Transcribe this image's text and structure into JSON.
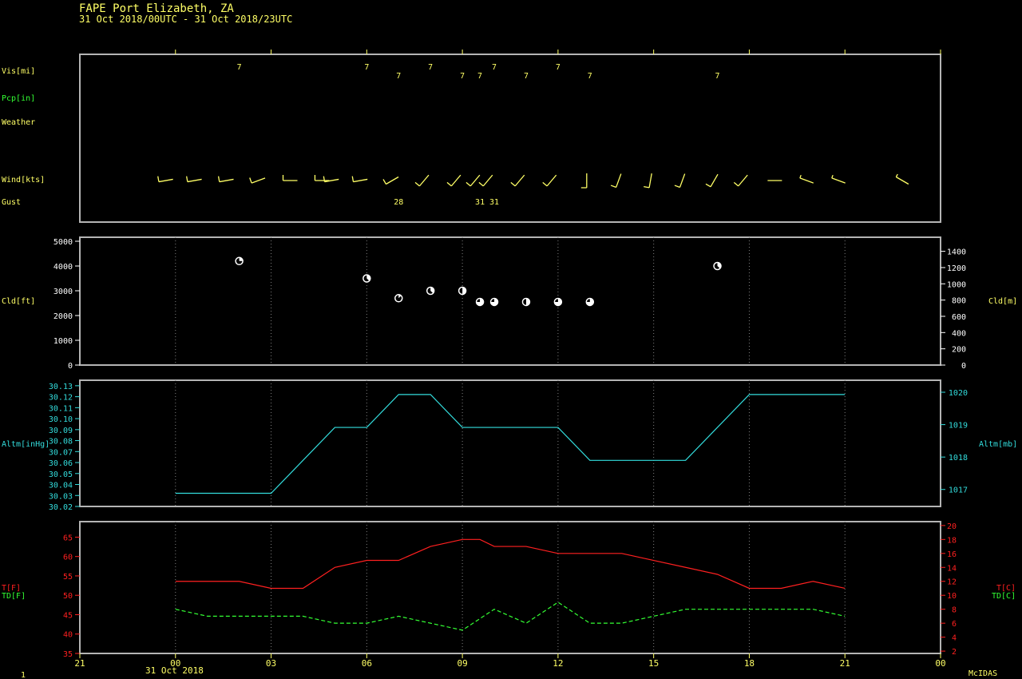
{
  "header": {
    "station": "FAPE  Port Elizabeth,  ZA",
    "period": "31 Oct 2018/00UTC - 31 Oct 2018/23UTC"
  },
  "footer": {
    "frame": "1",
    "date": "31 Oct 2018",
    "brand": "McIDAS"
  },
  "colors": {
    "frame": "#b4b4b4",
    "yellow": "#ffff66",
    "green": "#33ff33",
    "cyan": "#33dddd",
    "red": "#ff2020",
    "white": "#ffffff",
    "grid": "#808080"
  },
  "chart_data": [
    {
      "type": "scatter",
      "name": "station-obs",
      "row_labels": {
        "vis": "Vis[mi]",
        "pcp": "Pcp[in]",
        "weather": "Weather",
        "wind": "Wind[kts]",
        "gust": "Gust"
      },
      "visibility": {
        "x": [
          2,
          6,
          7,
          8,
          9,
          9.55,
          10,
          11,
          12,
          13,
          17
        ],
        "values": [
          "7",
          "7",
          "7",
          "7",
          "7",
          "7",
          "7",
          "7",
          "7",
          "7",
          "7"
        ]
      },
      "wind": {
        "x": [
          -0.3,
          0.6,
          1.6,
          2.6,
          3.6,
          4.6,
          4.9,
          5.8,
          6.8,
          7.8,
          8.8,
          9.4,
          9.8,
          10.8,
          11.8,
          12.9,
          13.9,
          14.9,
          15.9,
          16.9,
          17.8,
          18.8,
          19.8,
          20.8,
          22.8
        ],
        "dir_deg": [
          260,
          260,
          260,
          250,
          270,
          270,
          260,
          260,
          240,
          220,
          220,
          220,
          220,
          220,
          220,
          180,
          200,
          190,
          200,
          210,
          220,
          270,
          290,
          290,
          300
        ],
        "speed_kts": [
          10,
          10,
          10,
          10,
          10,
          10,
          10,
          10,
          10,
          10,
          10,
          10,
          10,
          10,
          10,
          10,
          10,
          10,
          10,
          10,
          10,
          0,
          5,
          5,
          5
        ]
      },
      "gust": {
        "x": [
          7,
          9.55,
          10
        ],
        "values": [
          "28",
          "31",
          "31"
        ]
      }
    },
    {
      "type": "scatter",
      "name": "cloud-base",
      "ylabel": "Cld[ft]",
      "ylabel_right": "Cld[m]",
      "ylim": [
        0,
        5000
      ],
      "yticks": [
        0,
        1000,
        2000,
        3000,
        4000,
        5000
      ],
      "yticks_right": [
        0,
        200,
        400,
        600,
        800,
        1000,
        1200,
        1400
      ],
      "x": [
        2,
        6,
        7,
        8,
        9,
        9.55,
        10,
        11,
        12,
        13,
        17
      ],
      "values": [
        4200,
        3500,
        2700,
        3000,
        3000,
        2550,
        2550,
        2550,
        2550,
        2550,
        4000
      ],
      "cover_eighths": [
        2,
        3,
        1,
        3,
        4,
        6,
        6,
        4,
        6,
        6,
        3
      ]
    },
    {
      "type": "line",
      "name": "altimeter",
      "ylabel": "Altm[inHg]",
      "ylabel_right": "Altm[mb]",
      "ylim": [
        30.02,
        30.135
      ],
      "yticks": [
        30.02,
        30.03,
        30.04,
        30.05,
        30.06,
        30.07,
        30.08,
        30.09,
        30.1,
        30.11,
        30.12,
        30.13
      ],
      "ytick_labels": [
        "30.02",
        "30.03",
        "30.04",
        "30.05",
        "30.06",
        "30.07",
        "30.08",
        "30.09",
        "30.10",
        "30.11",
        "30.12",
        "30.13"
      ],
      "yticks_right_mb": [
        1017,
        1018,
        1019,
        1020
      ],
      "x": [
        0,
        3,
        4,
        5,
        6,
        7,
        8,
        9,
        12,
        13,
        16,
        18,
        21
      ],
      "values": [
        30.032,
        30.032,
        30.062,
        30.092,
        30.092,
        30.122,
        30.122,
        30.092,
        30.092,
        30.062,
        30.062,
        30.122,
        30.122
      ]
    },
    {
      "type": "line",
      "name": "temperature",
      "ylabel": "T[F]",
      "ylabel2": "TD[F]",
      "ylabel_right": "T[C]",
      "ylabel_right2": "TD[C]",
      "ylim": [
        35,
        69
      ],
      "yticks": [
        35,
        40,
        45,
        50,
        55,
        60,
        65
      ],
      "yticks_right_c": [
        2,
        4,
        6,
        8,
        10,
        12,
        14,
        16,
        18,
        20
      ],
      "x": [
        -0.1,
        0,
        1,
        2,
        3,
        4,
        5,
        6,
        7,
        8,
        9,
        9.55,
        10,
        11,
        12,
        13,
        14,
        15,
        16,
        17,
        18,
        19,
        20,
        21,
        22,
        23,
        24
      ],
      "xticks": [
        -3,
        0,
        3,
        6,
        9,
        12,
        15,
        18,
        21,
        24
      ],
      "xtick_labels": [
        "21",
        "00",
        "03",
        "06",
        "09",
        "12",
        "15",
        "18",
        "21",
        "00"
      ],
      "series": [
        {
          "name": "T",
          "x": [
            0,
            2,
            3,
            4,
            5,
            6,
            7,
            8,
            9,
            9.55,
            10,
            11,
            12,
            13,
            14,
            15,
            16,
            17,
            18,
            19,
            20,
            21
          ],
          "values": [
            53.6,
            53.6,
            51.8,
            51.8,
            57.2,
            59,
            59,
            62.6,
            64.4,
            64.4,
            62.6,
            62.6,
            60.8,
            60.8,
            60.8,
            59,
            57.2,
            55.4,
            51.8,
            51.8,
            53.6,
            51.8
          ]
        },
        {
          "name": "TD",
          "x": [
            0,
            1,
            2,
            3,
            4,
            5,
            6,
            7,
            8,
            9,
            10,
            11,
            12,
            13,
            14,
            15,
            16,
            17,
            18,
            19,
            20,
            21
          ],
          "values": [
            46.4,
            44.6,
            44.6,
            44.6,
            44.6,
            42.8,
            42.8,
            44.6,
            42.8,
            41,
            46.4,
            42.8,
            48.2,
            42.8,
            42.8,
            44.6,
            46.4,
            46.4,
            46.4,
            46.4,
            46.4,
            44.6
          ]
        }
      ]
    }
  ]
}
